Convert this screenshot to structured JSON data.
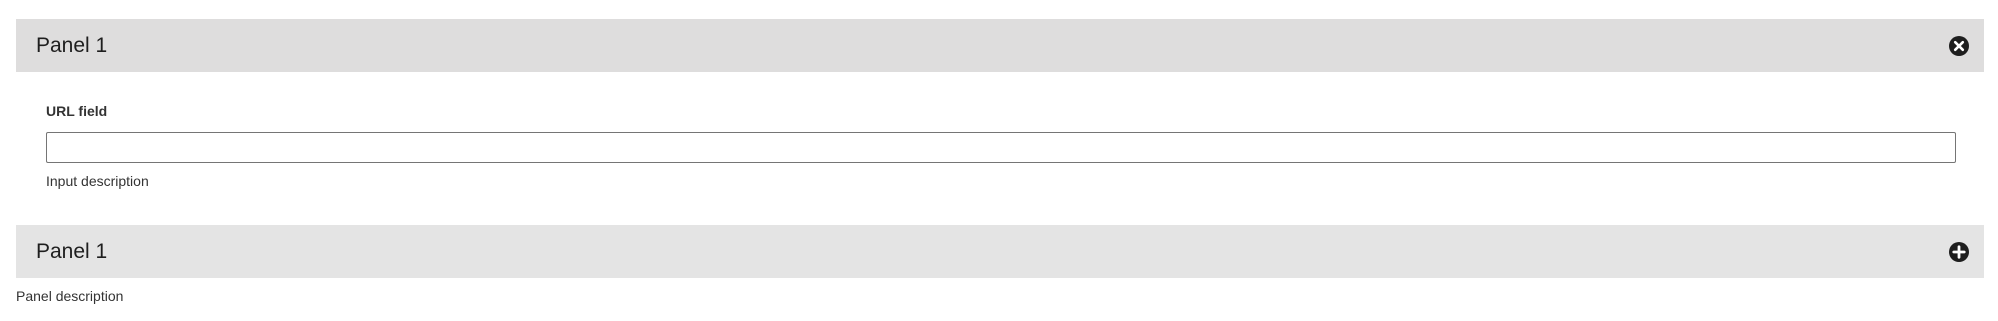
{
  "panels": [
    {
      "title": "Panel 1",
      "state": "expanded",
      "toggle_icon": "close-circle-icon",
      "field": {
        "label": "URL field",
        "value": "",
        "placeholder": "",
        "description": "Input description"
      }
    },
    {
      "title": "Panel 1",
      "state": "collapsed",
      "toggle_icon": "plus-circle-icon",
      "description": "Panel description"
    }
  ],
  "colors": {
    "header_open_bg": "#dedddd",
    "header_closed_bg": "#e4e4e4",
    "icon": "#1e1e1e",
    "input_border": "#757575"
  }
}
